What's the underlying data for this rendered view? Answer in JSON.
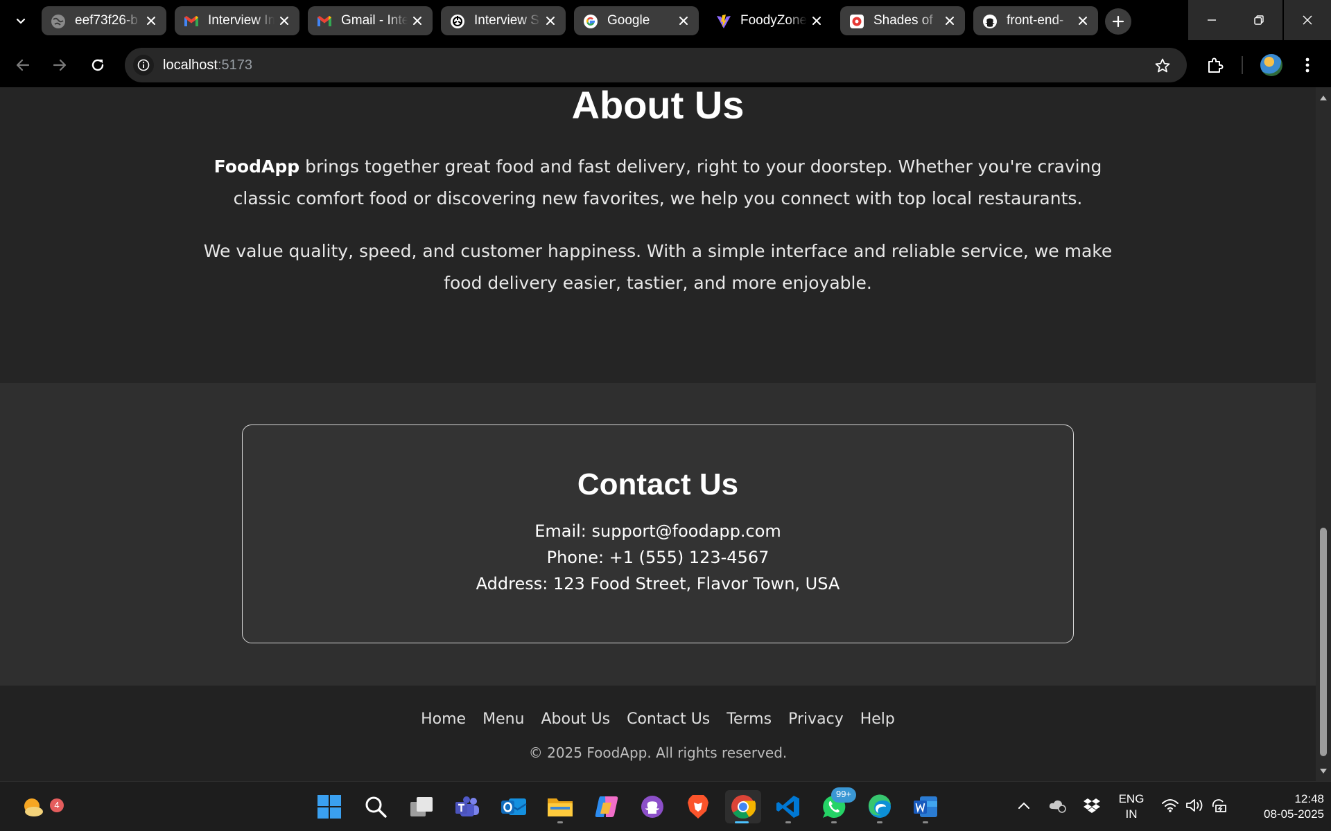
{
  "browser": {
    "tabs": [
      {
        "title": "eef73f26-b",
        "icon": "globe-icon"
      },
      {
        "title": "Interview In",
        "icon": "gmail-icon"
      },
      {
        "title": "Gmail - Inte",
        "icon": "gmail-icon"
      },
      {
        "title": "Interview So",
        "icon": "chatgpt-icon"
      },
      {
        "title": "Google",
        "icon": "google-icon"
      },
      {
        "title": "FoodyZone",
        "icon": "vite-icon"
      },
      {
        "title": "Shades of ",
        "icon": "record-icon"
      },
      {
        "title": "front-end-",
        "icon": "github-icon"
      }
    ],
    "url": {
      "host": "localhost",
      "port": ":5173"
    }
  },
  "page": {
    "about": {
      "heading": "About Us",
      "brand": "FoodApp",
      "para1_rest": " brings together great food and fast delivery, right to your doorstep. Whether you're craving classic comfort food or discovering new favorites, we help you connect with top local restaurants.",
      "para2": "We value quality, speed, and customer happiness. With a simple interface and reliable service, we make food delivery easier, tastier, and more enjoyable."
    },
    "contact": {
      "heading": "Contact Us",
      "email": "Email: support@foodapp.com",
      "phone": "Phone: +1 (555) 123-4567",
      "address": "Address: 123 Food Street, Flavor Town, USA"
    },
    "footer": {
      "links": [
        "Home",
        "Menu",
        "About Us",
        "Contact Us",
        "Terms",
        "Privacy",
        "Help"
      ],
      "copyright": "© 2025 FoodApp. All rights reserved."
    }
  },
  "taskbar": {
    "weather_badge": "4",
    "whatsapp_badge": "99+",
    "language_line1": "ENG",
    "language_line2": "IN",
    "time": "12:48",
    "date": "08-05-2025"
  },
  "colors": {
    "page_bg": "#252525",
    "contact_bg": "#2f2f2f",
    "footer_bg": "#222222",
    "accent_indicator": "#4cc2ff"
  }
}
